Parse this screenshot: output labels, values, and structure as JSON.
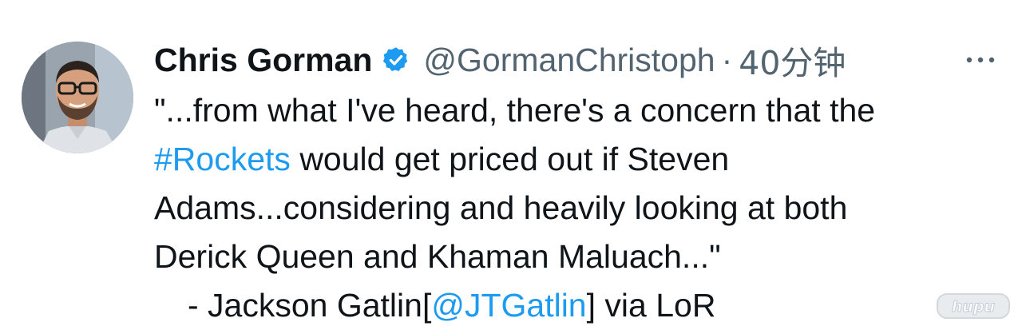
{
  "tweet": {
    "author": {
      "display_name": "Chris Gorman",
      "handle": "@GormanChristoph",
      "verified": true,
      "avatar": "profile-photo"
    },
    "separator": "·",
    "timestamp": "40分钟",
    "more_icon": "ellipsis-icon",
    "verified_icon": "verified-badge-icon",
    "body": {
      "line1": "\"...from what I've heard, there's a concern that the",
      "line2_link": "#Rockets",
      "line2_rest": " would get priced out if Steven",
      "line3": "Adams...considering and heavily looking at both",
      "line4": "Derick Queen and Khaman Maluach...\"",
      "line5_pre": "- Jackson Gatlin[",
      "line5_link": "@JTGatlin",
      "line5_post": "] via LoR"
    }
  },
  "watermark": {
    "text": "hupu"
  },
  "colors": {
    "text": "#0f1419",
    "secondary": "#536471",
    "link": "#1d9bf0",
    "verified": "#1d9bf0"
  }
}
